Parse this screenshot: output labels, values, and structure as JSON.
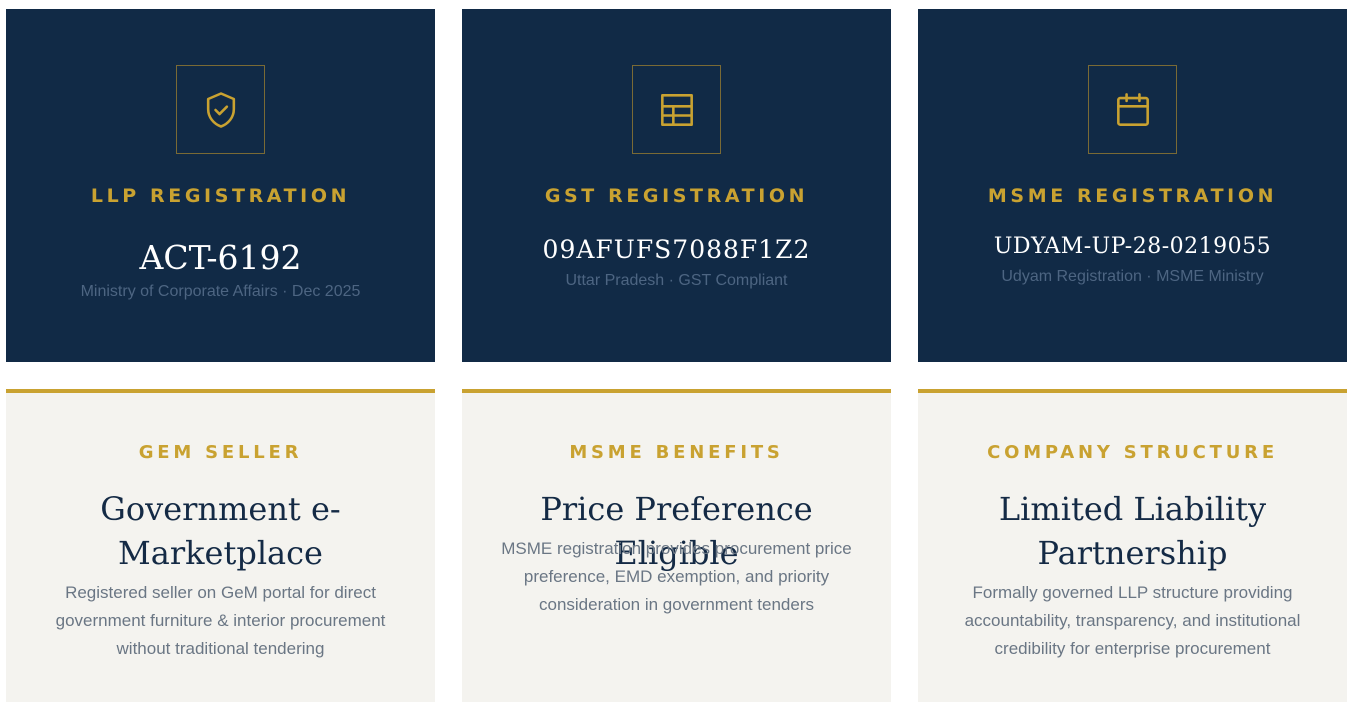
{
  "registrations": [
    {
      "heading": "LLP REGISTRATION",
      "number": "ACT-6192",
      "sub": "Ministry of Corporate Affairs · Dec 2025",
      "icon": "shield-check-icon"
    },
    {
      "heading": "GST REGISTRATION",
      "number": "09AFUFS7088F1Z2",
      "sub": "Uttar Pradesh · GST Compliant",
      "icon": "table-grid-icon"
    },
    {
      "heading": "MSME REGISTRATION",
      "number": "UDYAM-UP-28-0219055",
      "sub": "Udyam Registration · MSME Ministry",
      "icon": "calendar-icon"
    }
  ],
  "features": [
    {
      "heading": "GEM SELLER",
      "title": "Government e-Marketplace",
      "desc": "Registered seller on GeM portal for direct government furniture & interior procurement without traditional tendering"
    },
    {
      "heading": "MSME BENEFITS",
      "title": "Price Preference Eligible",
      "desc": "MSME registration provides procurement price preference, EMD exemption, and priority consideration in government tenders"
    },
    {
      "heading": "COMPANY STRUCTURE",
      "title": "Limited Liability Partnership",
      "desc": "Formally governed LLP structure providing accountability, transparency, and institutional credibility for enterprise procurement"
    }
  ],
  "colors": {
    "navy": "#112a46",
    "gold": "#c9a231",
    "cream": "#f4f3ef"
  }
}
